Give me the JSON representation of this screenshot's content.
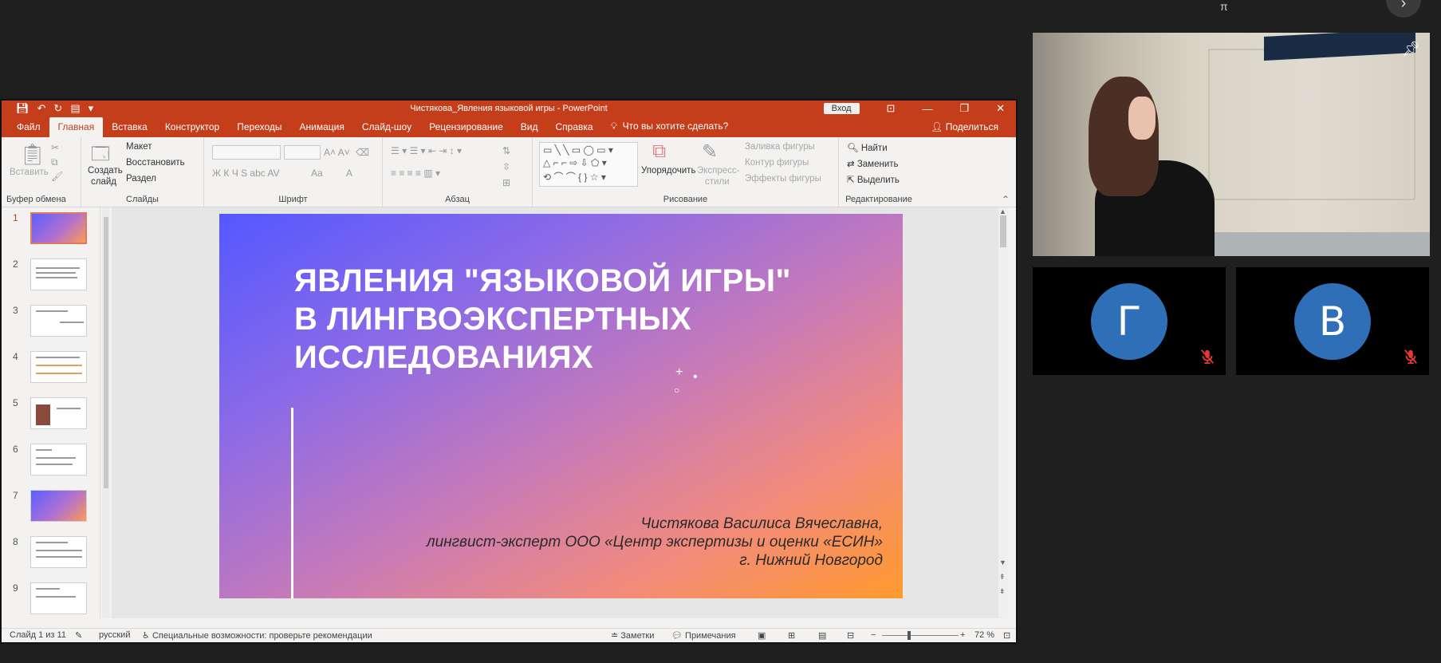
{
  "meeting": {
    "corner_text": "π",
    "corner_btn": "›"
  },
  "ppt": {
    "qat_icons": [
      "save-icon",
      "undo-icon",
      "redo-icon",
      "presentation-icon",
      "customize-icon"
    ],
    "doc_title": "Чистякова_Явления языковой игры  -  PowerPoint",
    "signin": "Вход",
    "tabs": [
      "Файл",
      "Главная",
      "Вставка",
      "Конструктор",
      "Переходы",
      "Анимация",
      "Слайд-шоу",
      "Рецензирование",
      "Вид",
      "Справка"
    ],
    "active_tab": "Главная",
    "tell_me": "Что вы хотите сделать?",
    "share": "Поделиться",
    "ribbon": {
      "clipboard": {
        "label": "Буфер обмена",
        "paste": "Вставить"
      },
      "slides": {
        "label": "Слайды",
        "new_slide_1": "Создать",
        "new_slide_2": "слайд",
        "layout": "Макет",
        "reset": "Восстановить",
        "section": "Раздел"
      },
      "font": {
        "label": "Шрифт",
        "buttons": "Ж  К  Ч  S  abc  AV",
        "aa": "Aa",
        "a_btn": "A",
        "grow": "A˄ A˅"
      },
      "paragraph": {
        "label": "Абзац"
      },
      "drawing": {
        "label": "Рисование",
        "arrange": "Упорядочить",
        "quick_styles_1": "Экспресс-",
        "quick_styles_2": "стили",
        "fill": "Заливка фигуры",
        "outline": "Контур фигуры",
        "effects": "Эффекты фигуры"
      },
      "editing": {
        "label": "Редактирование",
        "find": "Найти",
        "replace": "Заменить",
        "select": "Выделить"
      }
    },
    "thumbnails": [
      "1",
      "2",
      "3",
      "4",
      "5",
      "6",
      "7",
      "8",
      "9"
    ],
    "selected_slide": "1",
    "slide": {
      "title_lines": [
        "ЯВЛЕНИЯ \"ЯЗЫКОВОЙ ИГРЫ\"",
        "В ЛИНГВОЭКСПЕРТНЫХ",
        "ИССЛЕДОВАНИЯХ"
      ],
      "author_lines": [
        "Чистякова Василиса Вячеславна,",
        "лингвист-эксперт ООО «Центр экспертизы и оценки «ЕСИН»",
        "г. Нижний Новгород"
      ],
      "deco": [
        "+",
        "•",
        "○"
      ]
    },
    "status": {
      "slide_of": "Слайд 1 из 11",
      "language": "русский",
      "accessibility": "Специальные возможности: проверьте рекомендации",
      "notes": "Заметки",
      "comments": "Примечания",
      "zoom": "72 %"
    }
  },
  "participants": [
    {
      "initial": "Г",
      "mic": "muted"
    },
    {
      "initial": "В",
      "mic": "muted"
    }
  ],
  "colors": {
    "accent": "#c43e1c",
    "avatar": "#2f6fb7",
    "mute": "#e53935"
  }
}
